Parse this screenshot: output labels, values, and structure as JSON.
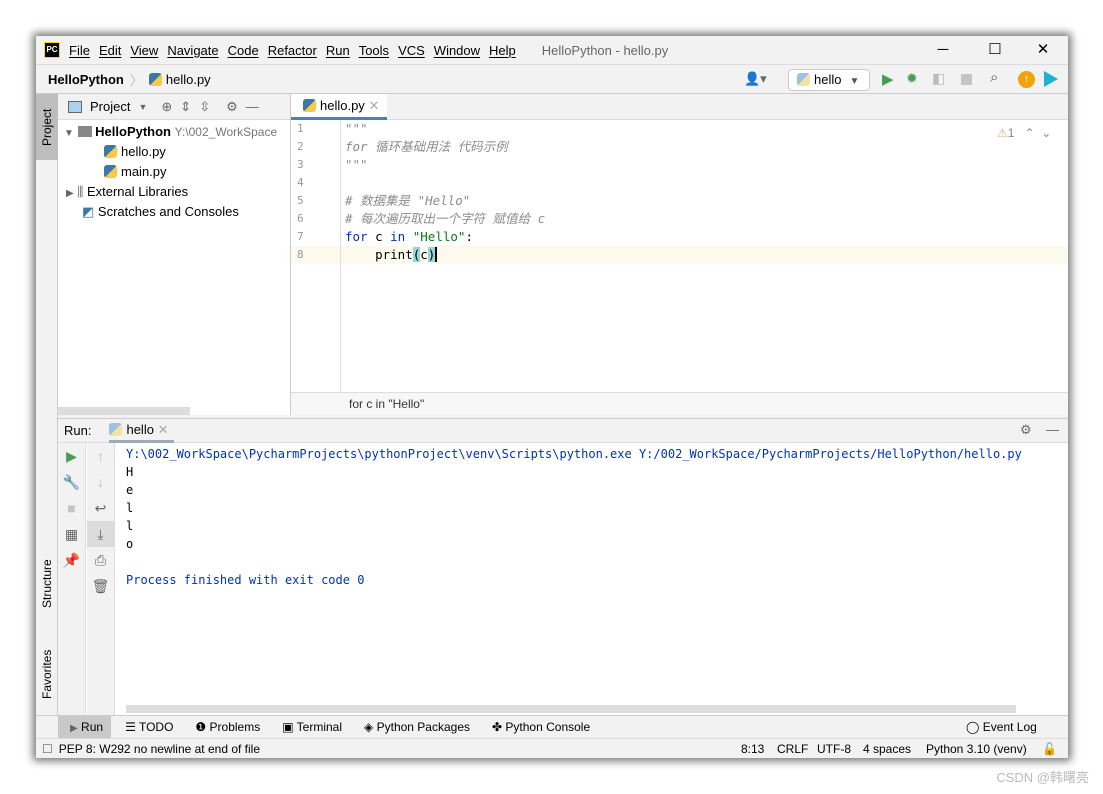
{
  "window": {
    "title": "HelloPython - hello.py",
    "logo": "PC",
    "minimize": "─",
    "maximize": "☐",
    "close": "✕"
  },
  "menu": [
    "File",
    "Edit",
    "View",
    "Navigate",
    "Code",
    "Refactor",
    "Run",
    "Tools",
    "VCS",
    "Window",
    "Help"
  ],
  "navbar": {
    "project": "HelloPython",
    "file": "hello.py",
    "run_config": "hello"
  },
  "left_strip": {
    "project": "Project",
    "structure": "Structure",
    "favorites": "Favorites"
  },
  "project_panel": {
    "title": "Project",
    "root": "HelloPython",
    "root_path": "Y:\\002_WorkSpace",
    "files": [
      "hello.py",
      "main.py"
    ],
    "external": "External Libraries",
    "scratches": "Scratches and Consoles"
  },
  "editor": {
    "tab": "hello.py",
    "warnings": "1",
    "breadcrumb": "for c in \"Hello\"",
    "line_numbers": [
      "1",
      "2",
      "3",
      "4",
      "5",
      "6",
      "7",
      "8"
    ],
    "lines": {
      "l1": "\"\"\"",
      "l2": "for 循环基础用法 代码示例",
      "l3": "\"\"\"",
      "l5": "# 数据集是 \"Hello\"",
      "l6": "# 每次遍历取出一个字符 赋值给 c",
      "l7_kw1": "for",
      "l7_mid": " c ",
      "l7_kw2": "in",
      "l7_str": "\"Hello\"",
      "l7_end": ":",
      "l8_fn": "    print",
      "l8_open": "(",
      "l8_c": "c",
      "l8_close": ")"
    }
  },
  "run_panel": {
    "label": "Run:",
    "tab": "hello",
    "output": [
      "Y:\\002_WorkSpace\\PycharmProjects\\pythonProject\\venv\\Scripts\\python.exe Y:/002_WorkSpace/PycharmProjects/HelloPython/hello.py",
      "H",
      "e",
      "l",
      "l",
      "o",
      "",
      "Process finished with exit code 0"
    ]
  },
  "bottom_tabs": [
    "Run",
    "TODO",
    "Problems",
    "Terminal",
    "Python Packages",
    "Python Console"
  ],
  "event_log": "Event Log",
  "status": {
    "message": "PEP 8: W292 no newline at end of file",
    "position": "8:13",
    "line_sep": "CRLF",
    "encoding": "UTF-8",
    "indent": "4 spaces",
    "interpreter": "Python 3.10 (venv)"
  },
  "watermark": "CSDN @韩曙亮",
  "colors": {
    "accent": "#4083c9",
    "run_green": "#499c54",
    "keyword": "#0033b3",
    "string": "#067d17",
    "comment": "#8c8c8c"
  }
}
